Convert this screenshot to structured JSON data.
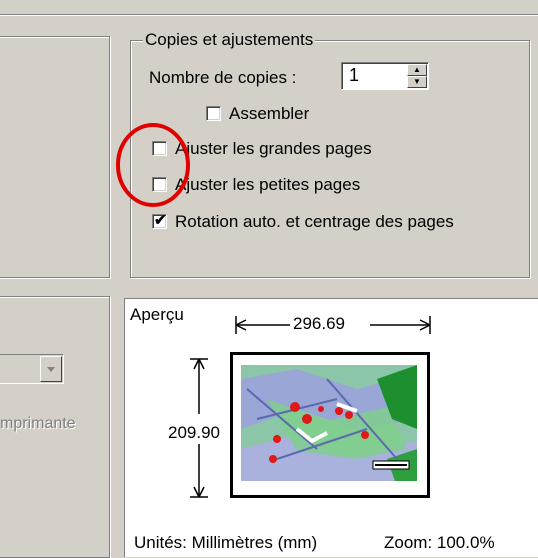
{
  "copies": {
    "group_title": "Copies et ajustements",
    "count_label": "Nombre de copies :",
    "count_value": "1",
    "collate_label": "Assembler",
    "fit_large_label": "Ajuster les grandes pages",
    "fit_small_label": "Ajuster les petites pages",
    "rotate_label": "Rotation auto. et centrage des pages",
    "collate_checked": false,
    "fit_large_checked": false,
    "fit_small_checked": false,
    "rotate_checked": true
  },
  "printer": {
    "printer_label": "mprimante"
  },
  "preview": {
    "title": "Aperçu",
    "width_value": "296.69",
    "height_value": "209.90",
    "units_label": "Unités: Millimètres (mm)",
    "zoom_label": "Zoom: 100.0%"
  },
  "annotation": {
    "circle_color": "#e00000"
  }
}
